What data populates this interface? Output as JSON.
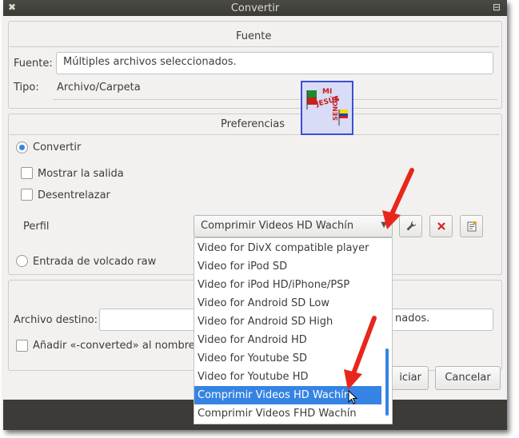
{
  "window": {
    "title": "Convertir",
    "close_glyph": "✖",
    "menu_glyph": "⊟"
  },
  "source": {
    "section_title": "Fuente",
    "fuente_label": "Fuente:",
    "fuente_value": "Múltiples archivos seleccionados.",
    "tipo_label": "Tipo:",
    "tipo_value": "Archivo/Carpeta"
  },
  "logo": {
    "lines": [
      "MI",
      "JESÚS",
      "SENOR"
    ]
  },
  "preferences": {
    "section_title": "Preferencias",
    "convert_label": "Convertir",
    "show_output_label": "Mostrar la salida",
    "deinterlace_label": "Desentrelazar",
    "profile_label": "Perfil",
    "profile_selected": "Comprimir Videos HD Wachín",
    "raw_dump_label": "Entrada de volcado raw"
  },
  "dropdown": {
    "items": [
      "Video for DivX compatible player",
      "Video for iPod SD",
      "Video for iPod HD/iPhone/PSP",
      "Video for Android SD Low",
      "Video for Android SD High",
      "Video for Android HD",
      "Video for Youtube SD",
      "Video for Youtube HD",
      "Comprimir Videos HD Wachín",
      "Comprimir Videos FHD Wachín"
    ],
    "selected_index": 8
  },
  "destination": {
    "file_label": "Archivo destino:",
    "file_value_visible": "nados.",
    "append_label": "Añadir «-converted» al nombre d"
  },
  "buttons": {
    "start_visible": "iciar",
    "cancel": "Cancelar"
  },
  "colors": {
    "accent": "#3584e4",
    "arrow": "#e8261c"
  }
}
